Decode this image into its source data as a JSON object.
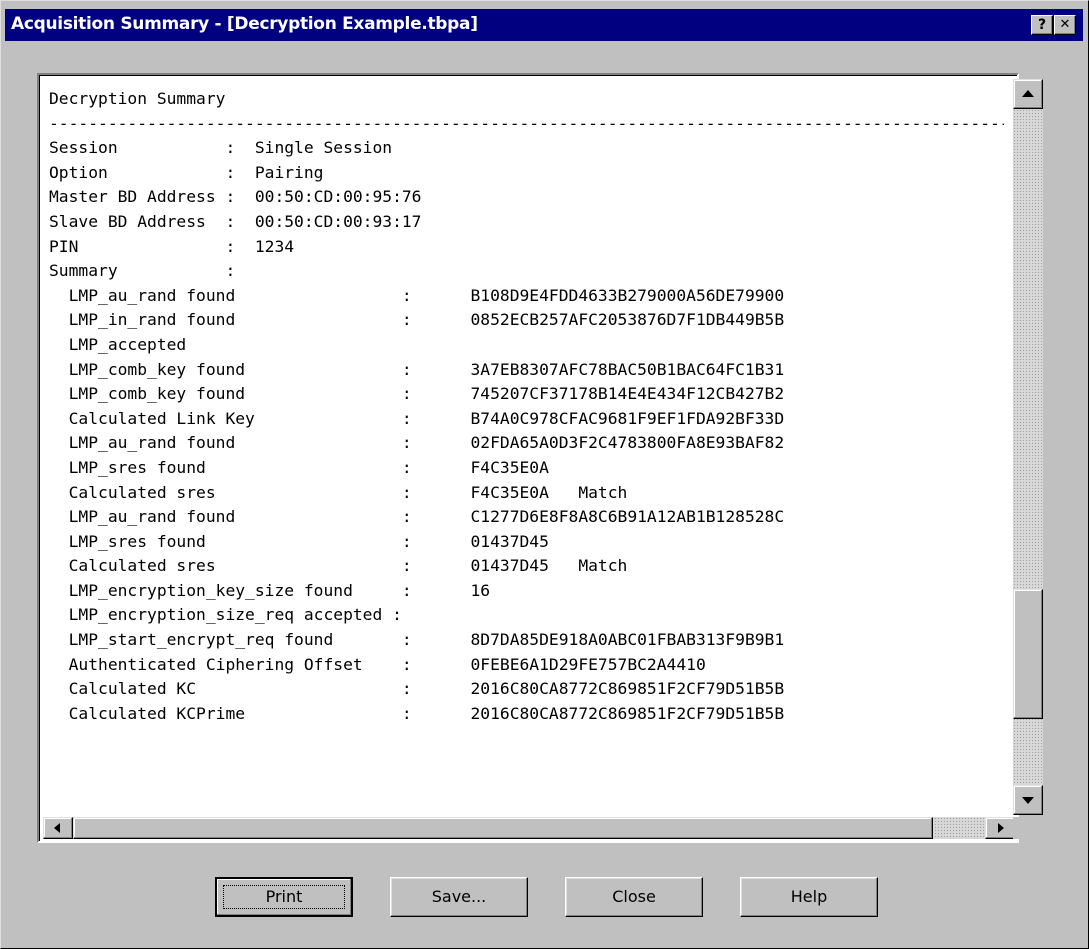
{
  "window": {
    "title": "Acquisition Summary - [Decryption Example.tbpa]",
    "help_label": "?",
    "close_label": "✕"
  },
  "summary_lines": [
    "Decryption Summary",
    "--------------------------------------------------------------------------------------------------------------",
    "Session           :  Single Session",
    "Option            :  Pairing",
    "Master BD Address :  00:50:CD:00:95:76",
    "Slave BD Address  :  00:50:CD:00:93:17",
    "PIN               :  1234",
    "Summary           :",
    "  LMP_au_rand found                 :      B108D9E4FDD4633B279000A56DE79900",
    "  LMP_in_rand found                 :      0852ECB257AFC2053876D7F1DB449B5B",
    "  LMP_accepted",
    "  LMP_comb_key found                :      3A7EB8307AFC78BAC50B1BAC64FC1B31",
    "  LMP_comb_key found                :      745207CF37178B14E4E434F12CB427B2",
    "  Calculated Link Key               :      B74A0C978CFAC9681F9EF1FDA92BF33D",
    "  LMP_au_rand found                 :      02FDA65A0D3F2C4783800FA8E93BAF82",
    "  LMP_sres found                    :      F4C35E0A",
    "  Calculated sres                   :      F4C35E0A   Match",
    "  LMP_au_rand found                 :      C1277D6E8F8A8C6B91A12AB1B128528C",
    "  LMP_sres found                    :      01437D45",
    "  Calculated sres                   :      01437D45   Match",
    "  LMP_encryption_key_size found     :      16",
    "  LMP_encryption_size_req accepted :",
    "  LMP_start_encrypt_req found       :      8D7DA85DE918A0ABC01FBAB313F9B9B1",
    "  Authenticated Ciphering Offset    :      0FEBE6A1D29FE757BC2A4410",
    "  Calculated KC                     :      2016C80CA8772C869851F2CF79D51B5B",
    "  Calculated KCPrime                :      2016C80CA8772C869851F2CF79D51B5B"
  ],
  "buttons": {
    "print": "Print",
    "save": "Save...",
    "close": "Close",
    "help": "Help"
  },
  "scroll": {
    "vertical_position": 0.88,
    "horizontal_position": 0.0
  },
  "icons": {
    "scroll_up": "arrow-up-icon",
    "scroll_down": "arrow-down-icon",
    "scroll_left": "arrow-left-icon",
    "scroll_right": "arrow-right-icon"
  }
}
